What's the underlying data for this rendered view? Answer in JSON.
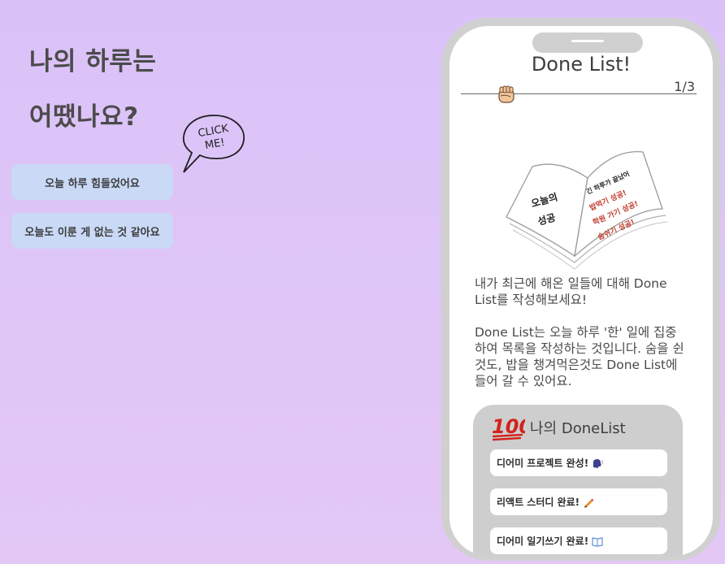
{
  "left": {
    "heading_line1": "나의 하루는",
    "heading_line2": "어땠나요?",
    "click_bubble": [
      "CLICK",
      "ME!"
    ],
    "choices": [
      "오늘 하루 힘들었어요",
      "오늘도 이룬 게 없는 것 같아요"
    ]
  },
  "phone": {
    "title": "Done List!",
    "page_indicator": "1/3",
    "progress_icon": "raised-fist-icon",
    "illustration": {
      "left_page": [
        "오늘의",
        "성공"
      ],
      "right_page": [
        "긴 하루가 끝났어",
        "밥먹기 성공!",
        "학원 가기 성공!",
        "숨쉬기 성공!"
      ]
    },
    "description_1": "내가 최근에 해온 일들에 대해 Done List를 작성해보세요!",
    "description_2": "Done List는 오늘 하루 '한' 일에 집중하여 목록을 작성하는 것입니다. 숨을 쉰것도, 밥을 챙겨먹은것도 Done List에 들어 갈 수 있어요.",
    "donelist": {
      "icon": "hundred-points-icon",
      "title": "나의 DoneList",
      "items": [
        {
          "text": "디어미 프로젝트 완성!",
          "icon": "speech-head-icon"
        },
        {
          "text": "리액트 스터디 완료!",
          "icon": "pencil-icon"
        },
        {
          "text": "디어미 일기쓰기 완료!",
          "icon": "book-icon"
        }
      ]
    }
  },
  "colors": {
    "background_top": "#dac2f8",
    "choice_button": "#c9d9f6",
    "phone_frame": "#d0d0d0",
    "panel": "#cecece"
  }
}
